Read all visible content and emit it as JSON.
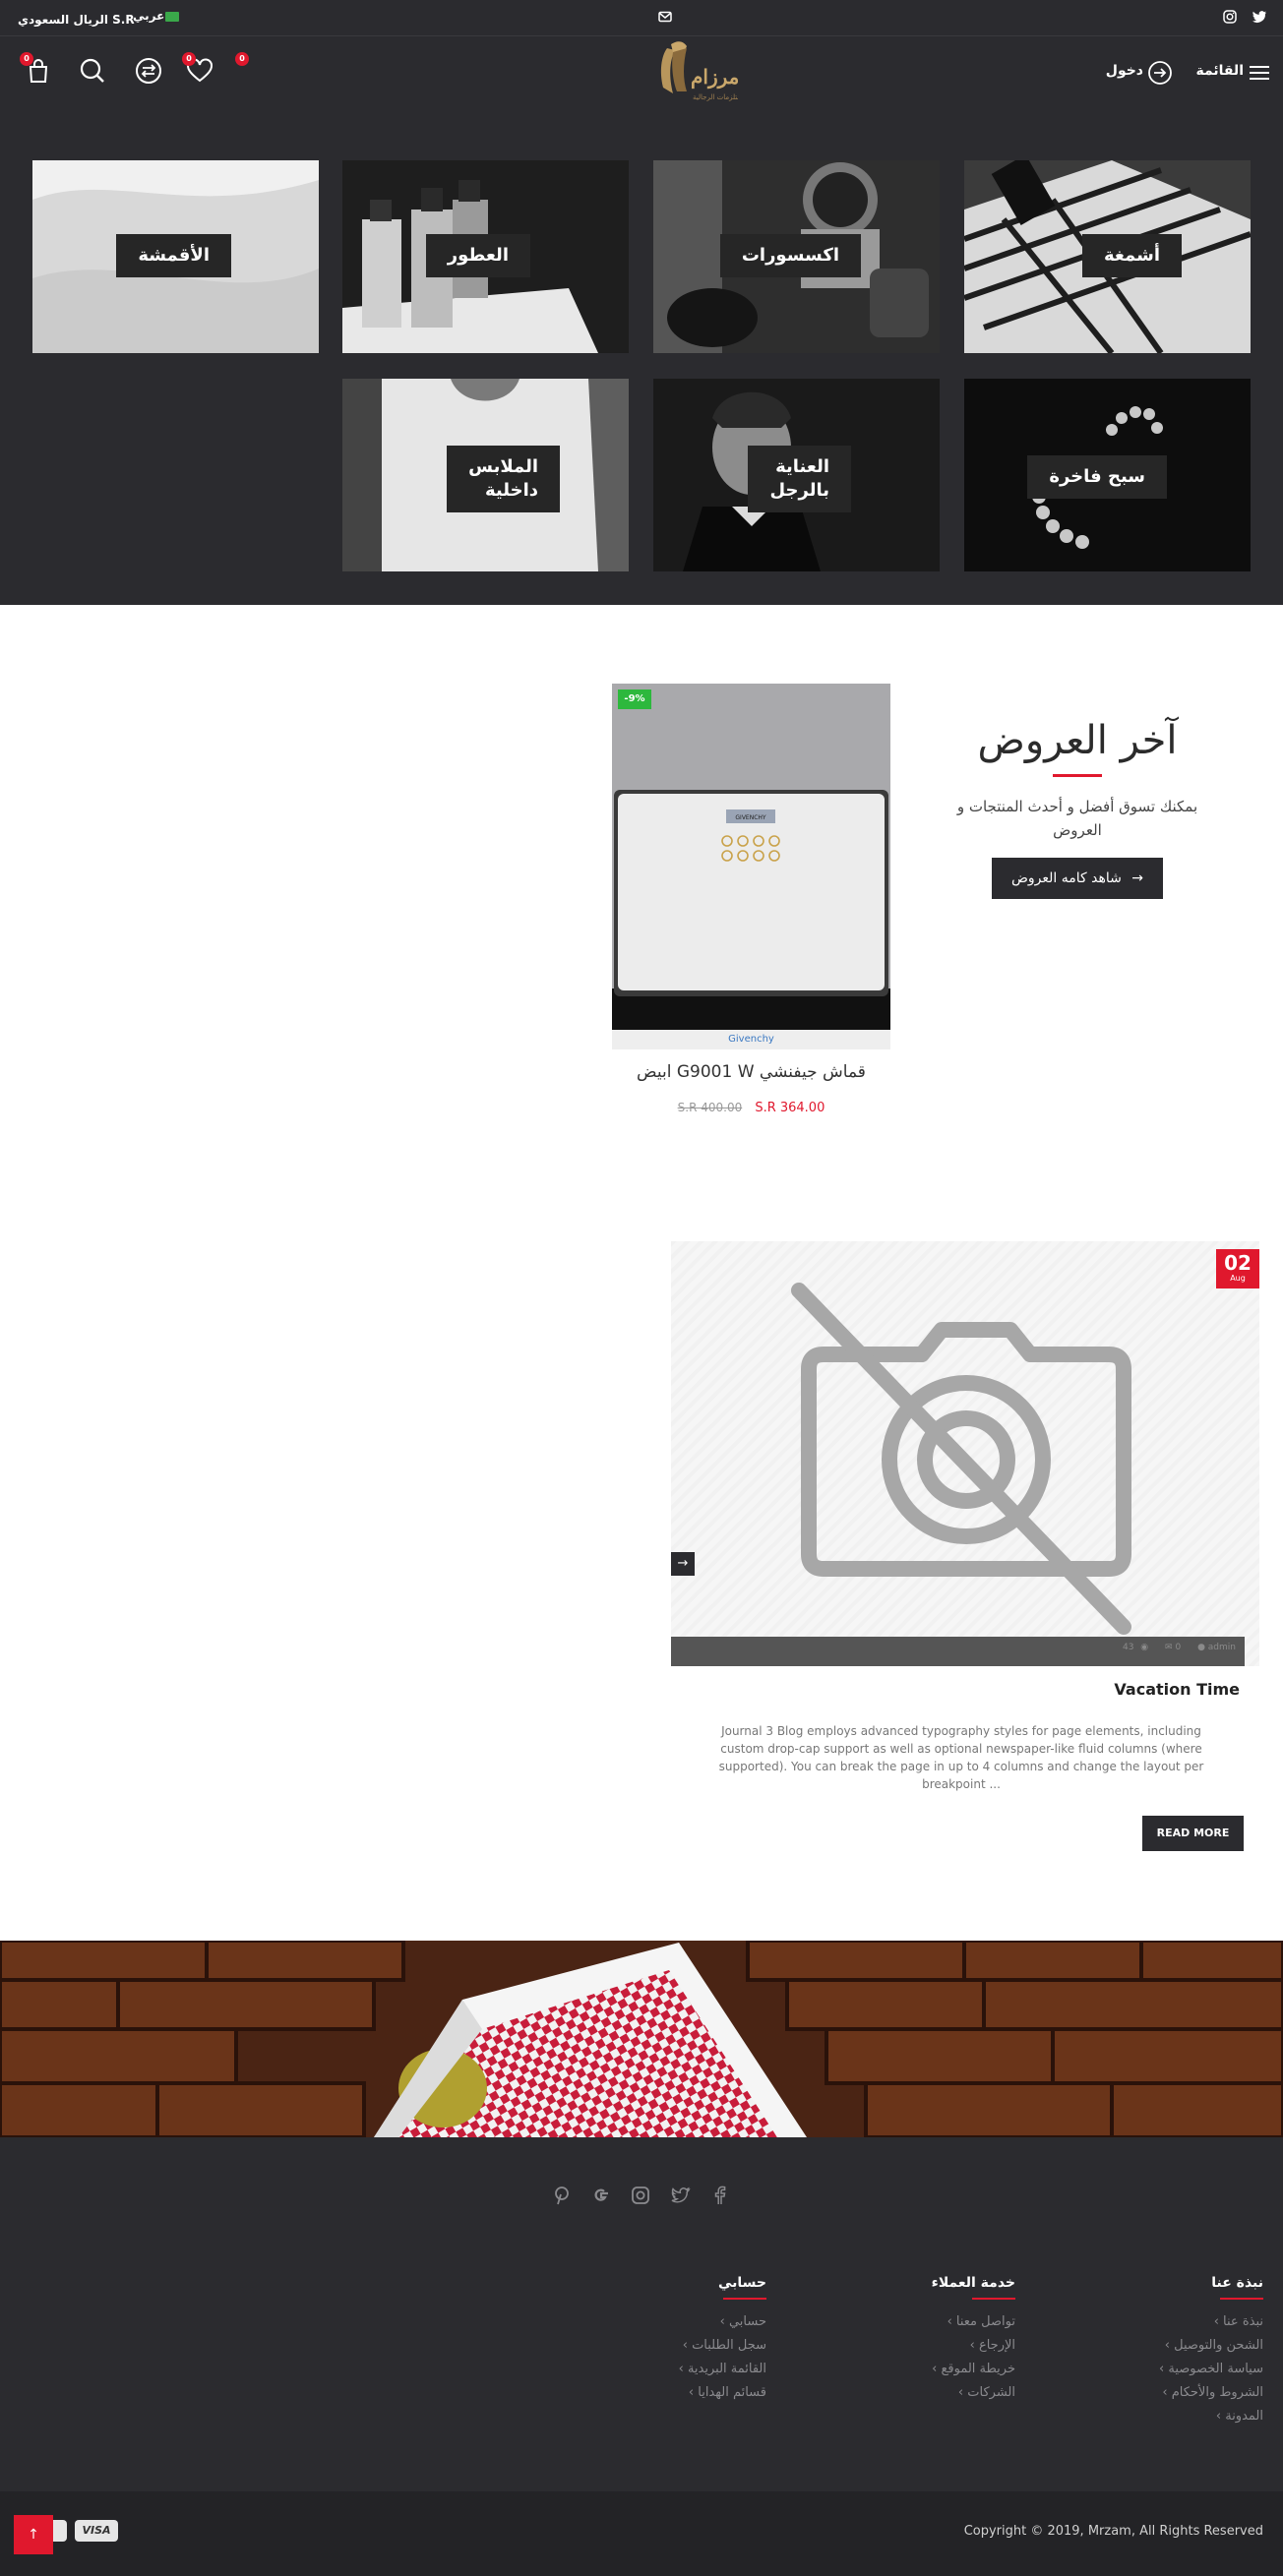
{
  "topbar": {
    "currency": "S.R الريال السعودي",
    "language": "عربي",
    "icons": [
      "twitter-icon",
      "instagram-icon",
      "mail-icon",
      "flag-icon"
    ]
  },
  "header": {
    "menu_label": "القائمة",
    "login_label": "دخول",
    "logo_text": "مرزام",
    "logo_sub": "للمستلزمات الرجالية",
    "wishlist_count": "0",
    "compare_count": "0",
    "cart_count": "0",
    "extra_count": "0"
  },
  "categories": [
    {
      "label": "أشمغة"
    },
    {
      "label": "اكسسورات"
    },
    {
      "label": "العطور"
    },
    {
      "label": "الأقمشة"
    },
    {
      "label": "سبح فاخرة"
    },
    {
      "label": "العناية\nبالرجل"
    },
    {
      "label": "الملابس\nداخلية"
    }
  ],
  "offers": {
    "title": "آخر العروض",
    "desc": "بمكنك تسوق أفضل و أحدث المنتجات و العروض",
    "button": "شاهد كامه العروض",
    "product": {
      "badge": "-9%",
      "brand": "Givenchy",
      "name": "قماش جيفنشي G9001 W ابيض",
      "price": "S.R 364.00",
      "old_price": "S.R 400.00",
      "box_label": "GIVENCHY"
    }
  },
  "blog": {
    "date_day": "02",
    "date_month": "Aug",
    "meta_views": "43",
    "meta_comments": "0",
    "meta_author": "admin",
    "title": "Vacation Time",
    "excerpt": "Journal 3 Blog employs advanced typography styles for page elements, including custom drop-cap support as well as optional newspaper-like fluid columns (where supported). You can break the page in up to 4 columns and change the layout per breakpoint ...",
    "read_more": "READ MORE"
  },
  "footer": {
    "social_icons": [
      "facebook-icon",
      "twitter-icon",
      "instagram-icon",
      "google-icon",
      "pinterest-icon"
    ],
    "columns": [
      {
        "title": "نبذة عنا",
        "links": [
          "نبذة عنا",
          "الشحن والتوصيل",
          "سياسة الخصوصية",
          "الشروط والأحكام",
          "المدونة"
        ]
      },
      {
        "title": "خدمة العملاء",
        "links": [
          "تواصل معنا",
          "الإرجاع",
          "خريطة الموقع",
          "الشركات"
        ]
      },
      {
        "title": "حسابي",
        "links": [
          "حسابي",
          "سجل الطلبات",
          "القائمة البريدية",
          "قسائم الهدايا"
        ]
      }
    ],
    "copyright": "Copyright © 2019, Mrzam, All Rights Reserved",
    "payment": [
      "VISA"
    ]
  },
  "colors": {
    "dark": "#2b2b2f",
    "accent": "#e0182d",
    "sale": "#2db83d"
  }
}
